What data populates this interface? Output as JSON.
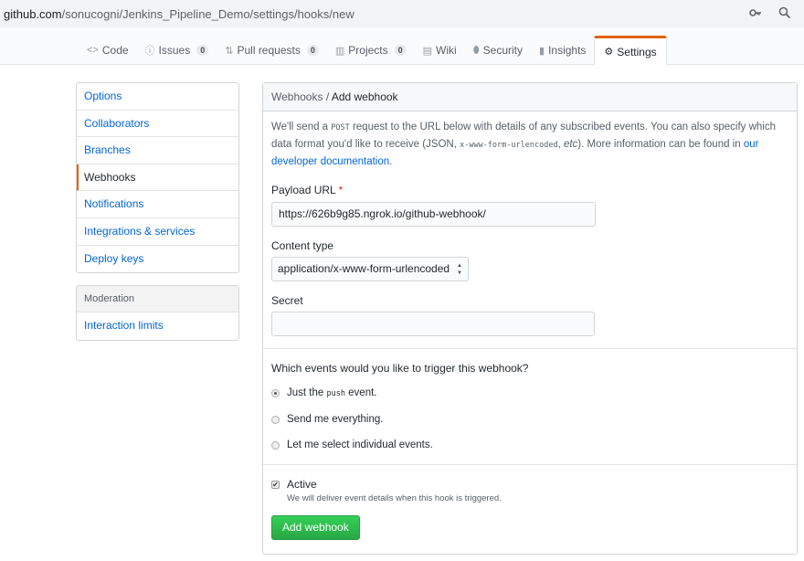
{
  "url": {
    "host": "github.com",
    "path": "/sonucogni/Jenkins_Pipeline_Demo/settings/hooks/new",
    "icons": [
      "key-icon",
      "search-icon"
    ]
  },
  "reponav": {
    "tabs": [
      {
        "label": "Code",
        "icon": "code-icon",
        "glyph": "<>"
      },
      {
        "label": "Issues",
        "icon": "issue-icon",
        "glyph": "ⓘ",
        "count": "0"
      },
      {
        "label": "Pull requests",
        "icon": "pull-request-icon",
        "glyph": "⇅",
        "count": "0"
      },
      {
        "label": "Projects",
        "icon": "project-icon",
        "glyph": "▥",
        "count": "0"
      },
      {
        "label": "Wiki",
        "icon": "book-icon",
        "glyph": "▤"
      },
      {
        "label": "Security",
        "icon": "shield-icon",
        "glyph": "⬮"
      },
      {
        "label": "Insights",
        "icon": "graph-icon",
        "glyph": "▮"
      },
      {
        "label": "Settings",
        "icon": "gear-icon",
        "glyph": "⚙"
      }
    ]
  },
  "sidebar": {
    "items": [
      "Options",
      "Collaborators",
      "Branches",
      "Webhooks",
      "Notifications",
      "Integrations & services",
      "Deploy keys"
    ],
    "moderation_heading": "Moderation",
    "moderation_items": [
      "Interaction limits"
    ]
  },
  "main": {
    "breadcrumb_parent": "Webhooks",
    "breadcrumb_sep": " / ",
    "breadcrumb_current": "Add webhook",
    "intro_1": "We'll send a ",
    "intro_code_1": "POST",
    "intro_2": " request to the URL below with details of any subscribed events. You can also specify which data format you'd like to receive (JSON, ",
    "intro_code_2": "x-www-form-urlencoded",
    "intro_3": ", ",
    "intro_etc": "etc",
    "intro_4": "). More information can be found in ",
    "intro_link": "our developer documentation",
    "intro_5": ".",
    "payload_label": "Payload URL",
    "required_mark": "*",
    "payload_value": "https://626b9g85.ngrok.io/github-webhook/",
    "content_type_label": "Content type",
    "content_type_value": "application/x-www-form-urlencoded",
    "secret_label": "Secret",
    "secret_value": "",
    "events_question": "Which events would you like to trigger this webhook?",
    "event_push_pre": "Just the ",
    "event_push_code": "push",
    "event_push_post": " event.",
    "event_everything": "Send me everything.",
    "event_individual": "Let me select individual events.",
    "active_label": "Active",
    "active_note": "We will deliver event details when this hook is triggered.",
    "submit_label": "Add webhook"
  },
  "colors": {
    "accent_tab": "#e36209",
    "link": "#0366d6",
    "button": "#28a745"
  }
}
